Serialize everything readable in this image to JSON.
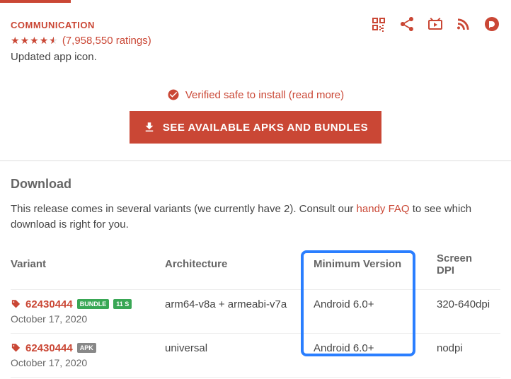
{
  "category": "COMMUNICATION",
  "rating": {
    "count": "(7,958,550 ratings)"
  },
  "description": "Updated app icon.",
  "verify": "Verified safe to install (read more)",
  "cta": "SEE AVAILABLE APKS AND BUNDLES",
  "download": {
    "title": "Download",
    "desc_before": "This release comes in several variants (we currently have 2). Consult our ",
    "link": "handy FAQ",
    "desc_after": " to see which download is right for you."
  },
  "headers": {
    "variant": "Variant",
    "arch": "Architecture",
    "min": "Minimum Version",
    "dpi": "Screen DPI"
  },
  "rows": [
    {
      "variant": "62430444",
      "badges": [
        {
          "label": "BUNDLE",
          "cls": "b-bundle"
        },
        {
          "label": "11 S",
          "cls": "b-11s"
        }
      ],
      "date": "October 17, 2020",
      "arch": "arm64-v8a + armeabi-v7a",
      "min": "Android 6.0+",
      "dpi": "320-640dpi"
    },
    {
      "variant": "62430444",
      "badges": [
        {
          "label": "APK",
          "cls": "b-apk"
        }
      ],
      "date": "October 17, 2020",
      "arch": "universal",
      "min": "Android 6.0+",
      "dpi": "nodpi"
    }
  ]
}
